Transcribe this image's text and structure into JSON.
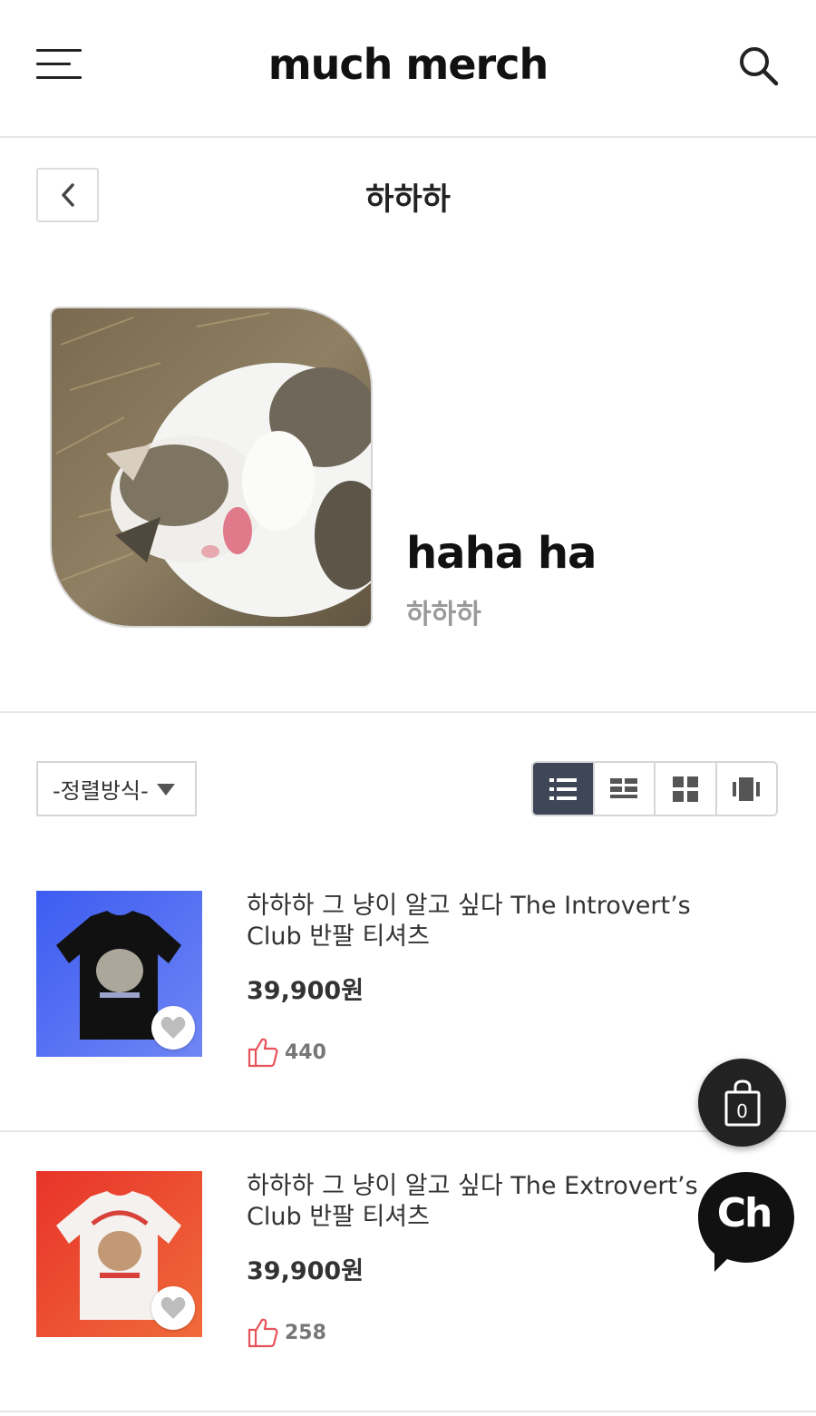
{
  "header": {
    "logo": "much merch",
    "menu_icon": "hamburger-menu-icon",
    "search_icon": "search-icon"
  },
  "subheader": {
    "back_icon": "chevron-left-icon",
    "title": "하하하"
  },
  "profile": {
    "image": "profile-cat-photo",
    "name": "haha ha",
    "subname": "하하하"
  },
  "toolbar": {
    "sort_label": "-정렬방식-",
    "view_modes": [
      "list-view-icon",
      "two-column-list-icon",
      "grid-view-icon",
      "carousel-view-icon"
    ],
    "active_view": "list-view-icon"
  },
  "products": [
    {
      "title": "하하하 그 냥이 알고 싶다 The Introvert’s Club 반팔 티셔츠",
      "price": "39,900원",
      "likes": "440",
      "thumb_bg": "#4e6af0",
      "shirt_color": "#111111"
    },
    {
      "title": "하하하 그 냥이 알고 싶다 The Extrovert’s Club 반팔 티셔츠",
      "price": "39,900원",
      "likes": "258",
      "thumb_bg": "#ec4a2c",
      "shirt_color": "#f4f1ee"
    }
  ],
  "cart": {
    "icon": "shopping-bag-icon",
    "count": "0"
  },
  "channel": {
    "icon": "channel-talk-icon",
    "label": "Ch"
  },
  "colors": {
    "active_view_bg": "#3f4657",
    "like_icon": "#e8525a"
  }
}
